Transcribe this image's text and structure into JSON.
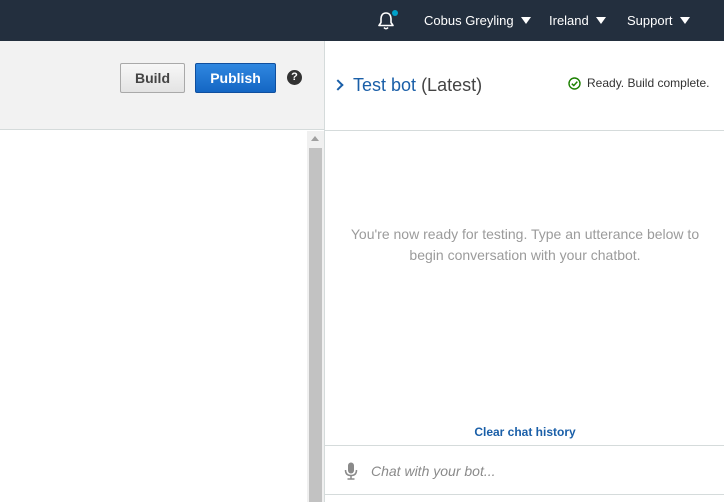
{
  "topbar": {
    "bell_icon": "bell-icon",
    "user": "Cobus Greyling",
    "region": "Ireland",
    "support": "Support",
    "colors": {
      "background": "#232f3e",
      "notification_dot": "#00a1c9"
    }
  },
  "editor": {
    "build_label": "Build",
    "publish_label": "Publish",
    "help_icon": "?",
    "colors": {
      "publish": "#1a6fd0"
    }
  },
  "test_panel": {
    "bot_name": "Test bot",
    "bot_version": "(Latest)",
    "status": "Ready. Build complete.",
    "status_icon": "check-circle-icon",
    "empty_message": "You're now ready for testing. Type an utterance below to begin conversation with your chatbot.",
    "clear_history": "Clear chat history",
    "chat_placeholder": "Chat with your bot...",
    "mic_icon": "microphone-icon",
    "colors": {
      "link": "#1a5fa8",
      "success": "#1d8102"
    }
  }
}
